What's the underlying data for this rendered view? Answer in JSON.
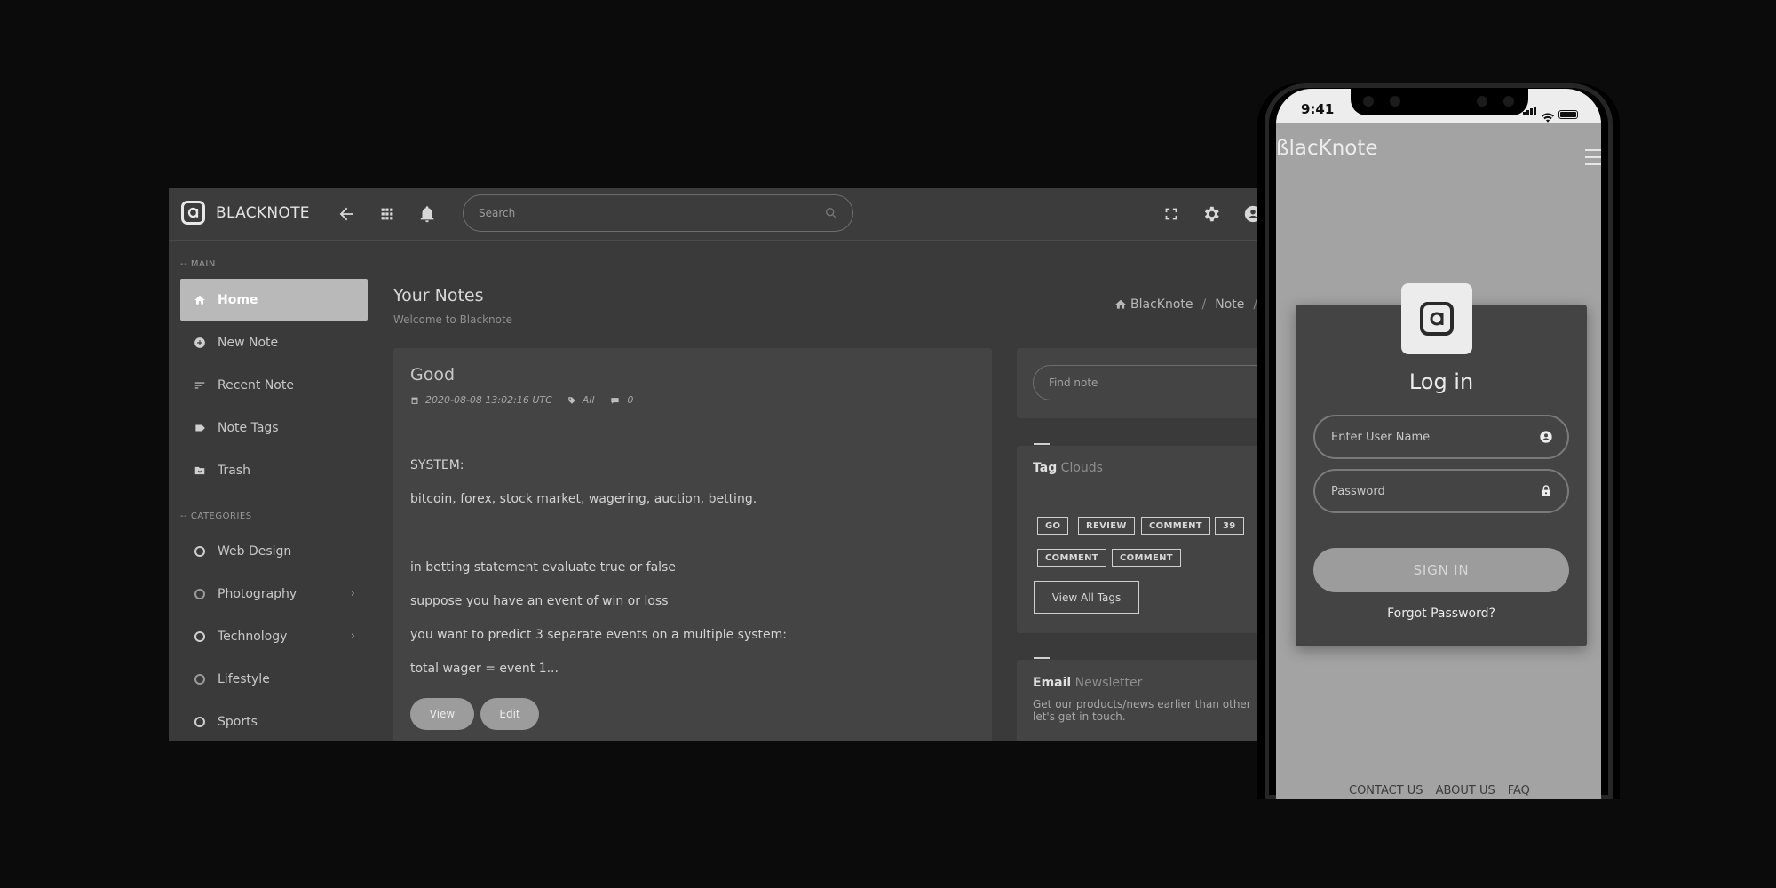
{
  "app": {
    "brand": "BLACKNOTE",
    "search_placeholder": "Search",
    "sidebar": {
      "main_section": "-- MAIN",
      "main_items": [
        {
          "label": "Home",
          "icon": "home-icon",
          "active": true
        },
        {
          "label": "New Note",
          "icon": "plus-circle-icon"
        },
        {
          "label": "Recent Note",
          "icon": "sort-icon"
        },
        {
          "label": "Note Tags",
          "icon": "tag-icon"
        },
        {
          "label": "Trash",
          "icon": "folder-icon"
        }
      ],
      "categories_section": "-- CATEGORIES",
      "categories": [
        {
          "label": "Web Design"
        },
        {
          "label": "Photography",
          "has_submenu": true
        },
        {
          "label": "Technology",
          "has_submenu": true
        },
        {
          "label": "Lifestyle"
        },
        {
          "label": "Sports"
        }
      ]
    },
    "page": {
      "title": "Your Notes",
      "subtitle": "Welcome to Blacknote",
      "breadcrumb": [
        "BlacKnote",
        "Note"
      ]
    },
    "note": {
      "title": "Good",
      "date": "2020-08-08 13:02:16 UTC",
      "tag": "All",
      "comments": "0",
      "lines": [
        "SYSTEM:",
        "bitcoin, forex, stock market, wagering, auction, betting.",
        "in betting statement evaluate true or false",
        "suppose you have an event of win or loss",
        "you want to predict 3 separate events on a multiple system:",
        "total wager = event 1..."
      ],
      "view_label": "View",
      "edit_label": "Edit"
    },
    "find_placeholder": "Find note",
    "tag_cloud": {
      "title_bold": "Tag",
      "title_rest": "Clouds",
      "tags": [
        "GO",
        "REVIEW",
        "COMMENT",
        "39",
        "COMMENT",
        "COMMENT"
      ],
      "view_all": "View All Tags"
    },
    "newsletter": {
      "title_bold": "Email",
      "title_rest": "Newsletter",
      "text": "Get our products/news earlier than other let's get in touch."
    }
  },
  "phone": {
    "time": "9:41",
    "brand": "ßlacKnote",
    "login_title": "Log in",
    "username_placeholder": "Enter User Name",
    "password_placeholder": "Password",
    "sign_in": "SIGN IN",
    "forgot": "Forgot Password?",
    "footer": [
      "CONTACT US",
      "ABOUT US",
      "FAQ"
    ]
  }
}
